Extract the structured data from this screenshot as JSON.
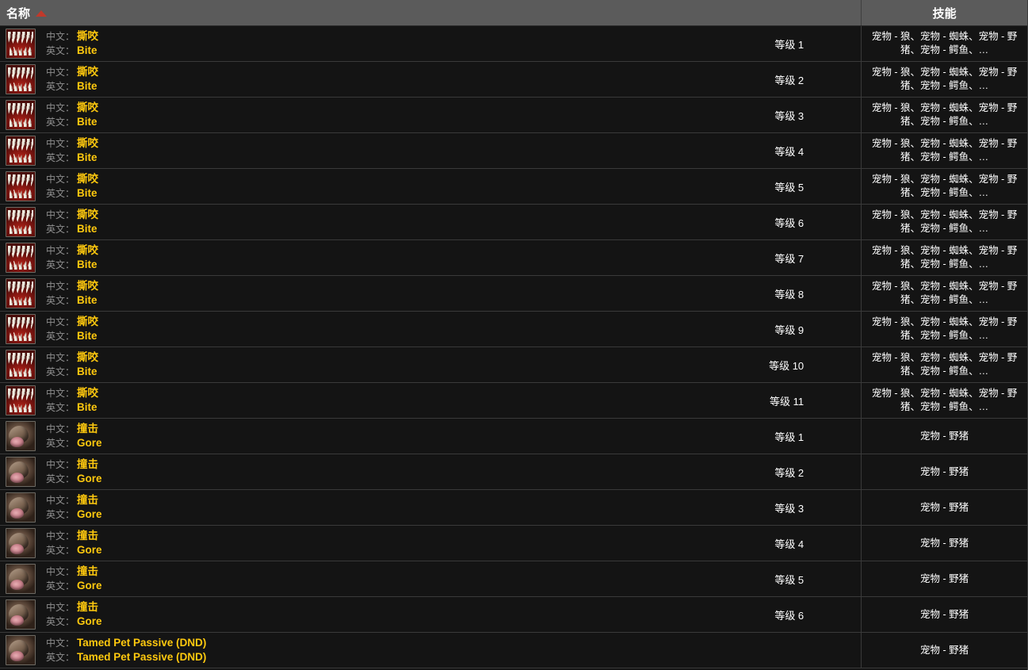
{
  "header": {
    "name_column": "名称",
    "skill_column": "技能",
    "sort_indicator": "sort-ascending-triangle",
    "sort_color": "#c0392b"
  },
  "labels": {
    "chinese": "中文：",
    "english": "英文："
  },
  "colors": {
    "header_bg": "#5b5b5b",
    "row_bg": "#141414",
    "row_border": "#3a3a3a",
    "value_text": "#ffc90e",
    "label_text": "#8d8d8d",
    "white_text": "#ffffff"
  },
  "rows": [
    {
      "icon": "bite-icon",
      "icon_class": "bite",
      "cn": "撕咬",
      "en": "Bite",
      "level": "等级 1",
      "skill": "宠物 - 狼、宠物 - 蜘蛛、宠物 - 野猪、宠物 - 鳄鱼、…"
    },
    {
      "icon": "bite-icon",
      "icon_class": "bite",
      "cn": "撕咬",
      "en": "Bite",
      "level": "等级 2",
      "skill": "宠物 - 狼、宠物 - 蜘蛛、宠物 - 野猪、宠物 - 鳄鱼、…"
    },
    {
      "icon": "bite-icon",
      "icon_class": "bite",
      "cn": "撕咬",
      "en": "Bite",
      "level": "等级 3",
      "skill": "宠物 - 狼、宠物 - 蜘蛛、宠物 - 野猪、宠物 - 鳄鱼、…"
    },
    {
      "icon": "bite-icon",
      "icon_class": "bite",
      "cn": "撕咬",
      "en": "Bite",
      "level": "等级 4",
      "skill": "宠物 - 狼、宠物 - 蜘蛛、宠物 - 野猪、宠物 - 鳄鱼、…"
    },
    {
      "icon": "bite-icon",
      "icon_class": "bite",
      "cn": "撕咬",
      "en": "Bite",
      "level": "等级 5",
      "skill": "宠物 - 狼、宠物 - 蜘蛛、宠物 - 野猪、宠物 - 鳄鱼、…"
    },
    {
      "icon": "bite-icon",
      "icon_class": "bite",
      "cn": "撕咬",
      "en": "Bite",
      "level": "等级 6",
      "skill": "宠物 - 狼、宠物 - 蜘蛛、宠物 - 野猪、宠物 - 鳄鱼、…"
    },
    {
      "icon": "bite-icon",
      "icon_class": "bite",
      "cn": "撕咬",
      "en": "Bite",
      "level": "等级 7",
      "skill": "宠物 - 狼、宠物 - 蜘蛛、宠物 - 野猪、宠物 - 鳄鱼、…"
    },
    {
      "icon": "bite-icon",
      "icon_class": "bite",
      "cn": "撕咬",
      "en": "Bite",
      "level": "等级 8",
      "skill": "宠物 - 狼、宠物 - 蜘蛛、宠物 - 野猪、宠物 - 鳄鱼、…"
    },
    {
      "icon": "bite-icon",
      "icon_class": "bite",
      "cn": "撕咬",
      "en": "Bite",
      "level": "等级 9",
      "skill": "宠物 - 狼、宠物 - 蜘蛛、宠物 - 野猪、宠物 - 鳄鱼、…"
    },
    {
      "icon": "bite-icon",
      "icon_class": "bite",
      "cn": "撕咬",
      "en": "Bite",
      "level": "等级 10",
      "skill": "宠物 - 狼、宠物 - 蜘蛛、宠物 - 野猪、宠物 - 鳄鱼、…"
    },
    {
      "icon": "bite-icon",
      "icon_class": "bite",
      "cn": "撕咬",
      "en": "Bite",
      "level": "等级 11",
      "skill": "宠物 - 狼、宠物 - 蜘蛛、宠物 - 野猪、宠物 - 鳄鱼、…"
    },
    {
      "icon": "gore-icon",
      "icon_class": "gore",
      "cn": "撞击",
      "en": "Gore",
      "level": "等级 1",
      "skill": "宠物 - 野猪"
    },
    {
      "icon": "gore-icon",
      "icon_class": "gore",
      "cn": "撞击",
      "en": "Gore",
      "level": "等级 2",
      "skill": "宠物 - 野猪"
    },
    {
      "icon": "gore-icon",
      "icon_class": "gore",
      "cn": "撞击",
      "en": "Gore",
      "level": "等级 3",
      "skill": "宠物 - 野猪"
    },
    {
      "icon": "gore-icon",
      "icon_class": "gore",
      "cn": "撞击",
      "en": "Gore",
      "level": "等级 4",
      "skill": "宠物 - 野猪"
    },
    {
      "icon": "gore-icon",
      "icon_class": "gore",
      "cn": "撞击",
      "en": "Gore",
      "level": "等级 5",
      "skill": "宠物 - 野猪"
    },
    {
      "icon": "gore-icon",
      "icon_class": "gore",
      "cn": "撞击",
      "en": "Gore",
      "level": "等级 6",
      "skill": "宠物 - 野猪"
    },
    {
      "icon": "gore-icon",
      "icon_class": "gore",
      "cn": "Tamed Pet Passive (DND)",
      "en": "Tamed Pet Passive (DND)",
      "level": "",
      "skill": "宠物 - 野猪"
    }
  ]
}
